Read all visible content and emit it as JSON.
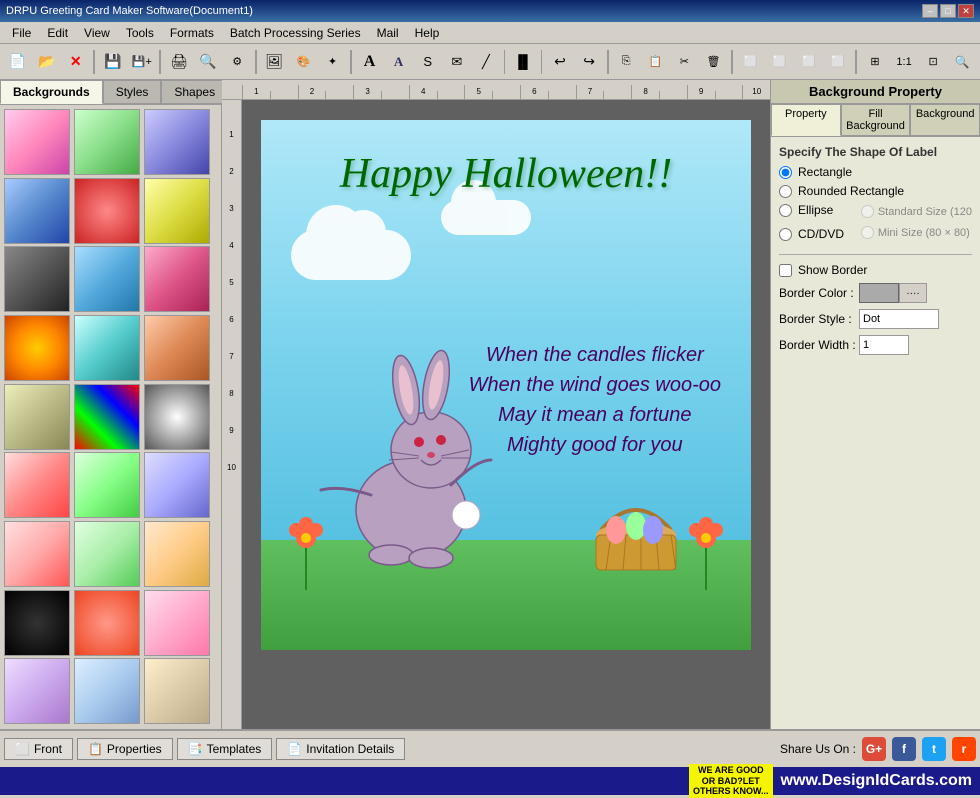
{
  "window": {
    "title": "DRPU Greeting Card Maker Software(Document1)",
    "min_btn": "–",
    "max_btn": "□",
    "close_btn": "✕"
  },
  "menu": {
    "items": [
      "File",
      "Edit",
      "View",
      "Tools",
      "Formats",
      "Batch Processing Series",
      "Mail",
      "Help"
    ]
  },
  "left_panel": {
    "tabs": [
      "Backgrounds",
      "Styles",
      "Shapes"
    ],
    "active_tab": "Backgrounds"
  },
  "card": {
    "title": "Happy Halloween!!",
    "lines": [
      "When the candles flicker",
      "When the wind goes woo-oo",
      "May it mean a fortune",
      "Mighty good for you"
    ]
  },
  "right_panel": {
    "title": "Background Property",
    "tabs": [
      "Property",
      "Fill Background",
      "Background"
    ],
    "active_tab": "Property",
    "section_label": "Specify The Shape Of Label",
    "shapes": [
      "Rectangle",
      "Rounded Rectangle",
      "Ellipse",
      "CD/DVD"
    ],
    "selected_shape": "Rectangle",
    "size_options": {
      "standard": "Standard Size (120",
      "mini": "Mini Size (80 × 80)"
    },
    "show_border_label": "Show Border",
    "border_color_label": "Border Color :",
    "border_style_label": "Border Style :",
    "border_style_value": "Dot",
    "border_width_label": "Border Width :",
    "border_width_value": "1"
  },
  "bottom_bar": {
    "front_label": "Front",
    "properties_label": "Properties",
    "templates_label": "Templates",
    "invitation_label": "Invitation Details",
    "share_label": "Share Us On :"
  },
  "footer": {
    "badge_text": "WE ARE GOOD\nOR BAD?LET\nOTHERS KNOW...",
    "url": "www.DesignIdCards.com"
  },
  "icons": {
    "new": "📄",
    "open": "📂",
    "close_doc": "✕",
    "save": "💾",
    "print_preview": "🔍",
    "print": "🖨",
    "undo": "↩",
    "redo": "↪",
    "zoom_in": "🔍",
    "front_icon": "⬜",
    "properties_icon": "📋",
    "templates_icon": "📑",
    "invitation_icon": "📄"
  }
}
